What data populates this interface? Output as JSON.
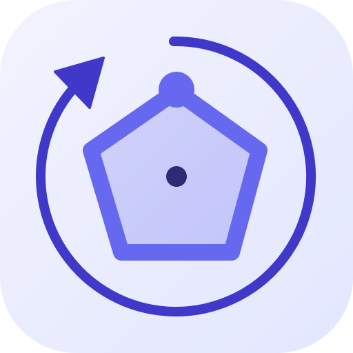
{
  "icon": {
    "name": "rotate-polygon-app-icon",
    "parts": [
      "rounded-square-background",
      "rotate-arrow-icon",
      "pentagon-icon",
      "vertex-handle-icon",
      "center-point-icon"
    ],
    "colors": {
      "background_start": "#F2F3FE",
      "background_end": "#E3E7FF",
      "arrow": "#4038C8",
      "pentagon_fill": "#C5C8FA",
      "pentagon_stroke": "#6668F0",
      "handle": "#6668F0",
      "center_dot": "#2D2A78"
    }
  }
}
